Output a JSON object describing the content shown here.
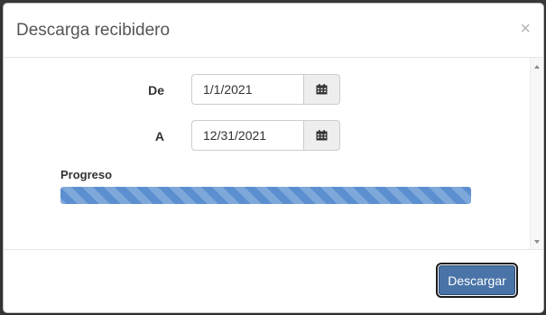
{
  "dialog": {
    "title": "Descarga recibidero",
    "close_symbol": "×"
  },
  "form": {
    "from_label": "De",
    "from_value": "1/1/2021",
    "to_label": "A",
    "to_value": "12/31/2021",
    "calendar_icon": "calendar-icon"
  },
  "progress": {
    "label": "Progreso",
    "percent": 100,
    "bar_color": "#5b8fd0"
  },
  "footer": {
    "download_label": "Descargar",
    "button_color": "#4a74a8"
  }
}
